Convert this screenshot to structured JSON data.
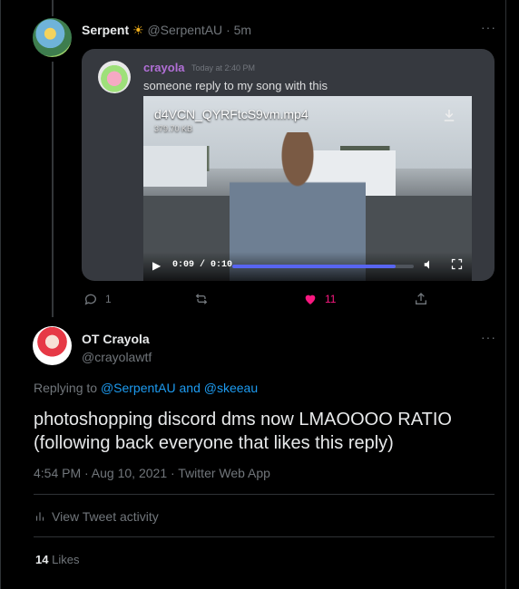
{
  "tweet1": {
    "name": "Serpent",
    "emoji": "☀",
    "handle": "@SerpentAU",
    "time": "· 5m",
    "more": "···",
    "quote": {
      "username": "crayola",
      "timestamp": "Today at 2:40 PM",
      "message": "someone reply to my song with this",
      "video": {
        "filename": "d4VCN_QYRFtcS9vm.mp4",
        "filesize": "379.70 KB",
        "time": "0:09 / 0:10",
        "progress": 0.9
      }
    },
    "actions": {
      "replies": "1",
      "retweets": "",
      "likes": "11"
    }
  },
  "tweet2": {
    "name": "OT Crayola",
    "handle": "@crayolawtf",
    "more": "···",
    "replying_prefix": "Replying to",
    "replying_to": "@SerpentAU and @skeeau",
    "text": "photoshopping discord dms now LMAOOOO RATIO (following back everyone that likes this reply)",
    "meta": "4:54 PM · Aug 10, 2021 · Twitter Web App",
    "activity_label": "View Tweet activity",
    "likes_count": "14",
    "likes_label": "Likes"
  },
  "colors": {
    "like": "#f91880",
    "link": "#1d9bf0",
    "discord_bg": "#36393f",
    "progress": "#5865f2"
  }
}
